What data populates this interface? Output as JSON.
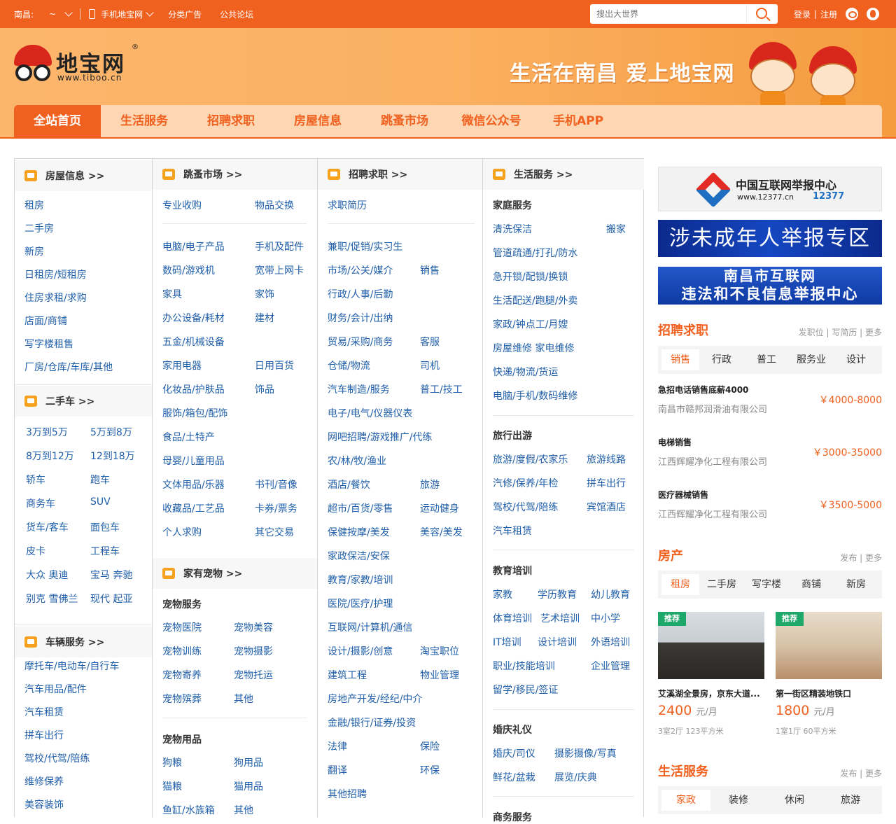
{
  "topbar": {
    "city": "南昌:",
    "city_switch": "~",
    "mobile": "手机地宝网",
    "classified": "分类广告",
    "forum": "公共论坛",
    "search_placeholder": "搜出大世界",
    "login": "登录",
    "sep": "|",
    "register": "注册"
  },
  "header": {
    "logo_name": "地宝网",
    "logo_url": "www.tiboo.cn",
    "logo_reg": "®",
    "slogan": "生活在南昌  爱上地宝网"
  },
  "nav": [
    "全站首页",
    "生活服务",
    "招聘求职",
    "房屋信息",
    "跳蚤市场",
    "微信公众号",
    "手机APP"
  ],
  "col1": {
    "house_title": "房屋信息 >>",
    "house_links": [
      "租房",
      "二手房",
      "新房",
      "日租房/短租房",
      "住房求租/求购",
      "店面/商铺",
      "写字楼租售",
      "厂房/仓库/车库/其他"
    ],
    "car_title": "二手车 >>",
    "car_links": [
      "3万到5万",
      "5万到8万",
      "8万到12万",
      "12到18万",
      "轿车",
      "跑车",
      "商务车",
      "SUV",
      "货车/客车",
      "面包车",
      "皮卡",
      "工程车",
      "大众 奥迪",
      "宝马 奔驰",
      "别克 雪佛兰",
      "现代 起亚"
    ],
    "vehicle_title": "车辆服务 >>",
    "vehicle_links": [
      "摩托车/电动车/自行车",
      "汽车用品/配件",
      "汽车租赁",
      "拼车出行",
      "驾校/代驾/陪练",
      "维修保养",
      "美容装饰"
    ]
  },
  "col2": {
    "title": "跳蚤市场 >>",
    "links": [
      "专业收购",
      "物品交换",
      "电脑/电子产品",
      "手机及配件",
      "数码/游戏机",
      "宽带上网卡",
      "家具",
      "家饰",
      "办公设备/耗材",
      "建材",
      "五金/机械设备",
      "家用电器",
      "日用百货",
      "化妆品/护肤品",
      "饰品",
      "服饰/箱包/配饰",
      "食品/土特产",
      "母婴/儿童用品",
      "文体用品/乐器",
      "书刊/音像",
      "收藏品/工艺品",
      "卡券/票务",
      "个人求购",
      "其它交易"
    ],
    "pet_title": "家有宠物 >>",
    "pet_service": "宠物服务",
    "pet_service_links": [
      "宠物医院",
      "宠物美容",
      "宠物训练",
      "宠物摄影",
      "宠物寄养",
      "宠物托运",
      "宠物殡葬",
      "其他"
    ],
    "pet_goods": "宠物用品",
    "pet_goods_links": [
      "狗粮",
      "狗用品",
      "猫粮",
      "猫用品",
      "鱼缸/水族箱",
      "其他"
    ]
  },
  "col3": {
    "title": "招聘求职 >>",
    "links": [
      "求职简历",
      "兼职/促销/实习生",
      "市场/公关/媒介",
      "销售",
      "行政/人事/后勤",
      "财务/会计/出纳",
      "贸易/采购/商务",
      "客服",
      "仓储/物流",
      "司机",
      "汽车制造/服务",
      "普工/技工",
      "电子/电气/仪器仪表",
      "网吧招聘/游戏推广/代练",
      "农/林/牧/渔业",
      "酒店/餐饮",
      "旅游",
      "超市/百货/零售",
      "运动健身",
      "保健按摩/美发",
      "美容/美发",
      "家政保洁/安保",
      "教育/家教/培训",
      "医院/医疗/护理",
      "互联网/计算机/通信",
      "设计/摄影/创意",
      "淘宝职位",
      "建筑工程",
      "物业管理",
      "房地产开发/经纪/中介",
      "金融/银行/证券/投资",
      "法律",
      "保险",
      "翻译",
      "环保",
      "其他招聘"
    ]
  },
  "col4": {
    "title": "生活服务 >>",
    "home": "家庭服务",
    "home_links": [
      "清洗保洁",
      "搬家",
      "管道疏通/打孔/防水",
      "急开锁/配锁/换锁",
      "生活配送/跑腿/外卖",
      "家政/钟点工/月嫂",
      "房屋维修 家电维修",
      "快递/物流/货运",
      "电脑/手机/数码维修"
    ],
    "travel": "旅行出游",
    "travel_links": [
      "旅游/度假/农家乐",
      "旅游线路",
      "汽修/保养/年检",
      "拼车出行",
      "驾校/代驾/陪练",
      "宾馆酒店",
      "汽车租赁"
    ],
    "edu": "教育培训",
    "edu_links": [
      "家教",
      "学历教育",
      "幼儿教育",
      "体育培训",
      "艺术培训",
      "中小学",
      "IT培训",
      "设计培训",
      "外语培训",
      "职业/技能培训",
      "企业管理",
      "留学/移民/签证"
    ],
    "wedding": "婚庆礼仪",
    "wedding_links": [
      "婚庆/司仪",
      "摄影摄像/写真",
      "鲜花/盆栽",
      "展览/庆典"
    ],
    "biz": "商务服务"
  },
  "side": {
    "ban1_t1": "中国互联网举报中心",
    "ban1_t2": "www.12377.cn",
    "ban1_t3": "12377",
    "ban2": "涉未成年人举报专区",
    "ban3_l1": "南昌市互联网",
    "ban3_l2": "违法和不良信息举报中心",
    "jobs_title": "招聘求职",
    "jobs_actions": "发职位 | 写简历 | 更多",
    "job_tabs": [
      "销售",
      "行政",
      "普工",
      "服务业",
      "设计"
    ],
    "jobs": [
      {
        "title": "急招电话销售底薪4000",
        "company": "南昌市赣邦润滑油有限公司",
        "salary": "￥4000-8000"
      },
      {
        "title": "电梯销售",
        "company": "江西辉耀净化工程有限公司",
        "salary": "￥3000-35000"
      },
      {
        "title": "医疗器械销售",
        "company": "江西辉耀净化工程有限公司",
        "salary": "￥3500-5000"
      }
    ],
    "house_title": "房产",
    "house_actions": "发布 | 更多",
    "house_tabs": [
      "租房",
      "二手房",
      "写字楼",
      "商铺",
      "新房"
    ],
    "houses": [
      {
        "tag": "推荐",
        "title": "艾溪湖全景房，京东大道...",
        "price": "2400",
        "unit": "元/月",
        "info": "3室2厅 123平方米"
      },
      {
        "tag": "推荐",
        "title": "第一街区精装地铁口",
        "price": "1800",
        "unit": "元/月",
        "info": "1室1厅 60平方米"
      }
    ],
    "life_title": "生活服务",
    "life_actions": "发布 | 更多",
    "life_tabs": [
      "家政",
      "装修",
      "休闲",
      "旅游"
    ]
  },
  "colors": {
    "brand": "#f0601e",
    "link": "#1f5ea8",
    "nav_bg": "#fdd7b4"
  }
}
